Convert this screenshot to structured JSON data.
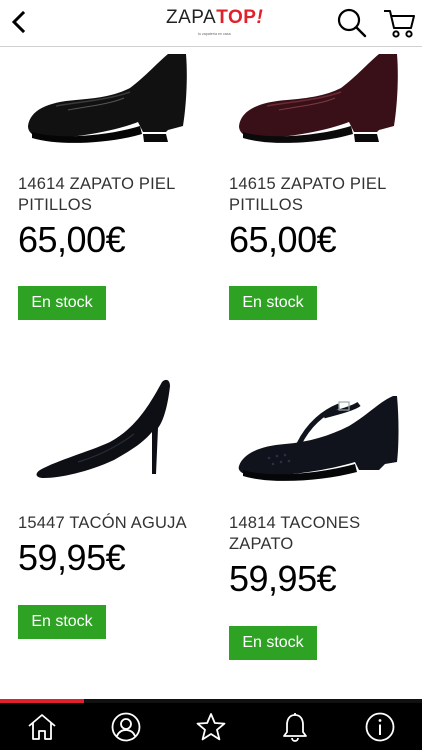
{
  "header": {
    "logo": {
      "brand_left": "ZAPA",
      "brand_right": "TOP",
      "brand_mark": "!",
      "tagline": "tu zapatería en casa"
    }
  },
  "products": [
    {
      "name": "14614 ZAPATO PIEL PITILLOS",
      "price": "65,00€",
      "stock": "En stock",
      "color": "#111111"
    },
    {
      "name": "14615 ZAPATO PIEL PITILLOS",
      "price": "65,00€",
      "stock": "En stock",
      "color": "#3a1018"
    },
    {
      "name": "15447 TACÓN AGUJA",
      "price": "59,95€",
      "stock": "En stock",
      "color": "#0d0f14"
    },
    {
      "name": "14814 TACONES ZAPATO",
      "price": "59,95€",
      "stock": "En stock",
      "color": "#10131c"
    }
  ],
  "nav": {
    "items": [
      {
        "icon": "home-icon"
      },
      {
        "icon": "user-icon"
      },
      {
        "icon": "star-icon"
      },
      {
        "icon": "bell-icon"
      },
      {
        "icon": "info-icon"
      }
    ],
    "progress": 0.2
  },
  "colors": {
    "accent_red": "#e0202a",
    "stock_green": "#2ea323",
    "nav_bg": "#000000"
  }
}
